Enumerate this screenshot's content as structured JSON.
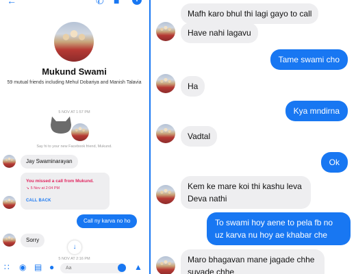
{
  "left": {
    "header_icons": [
      "back-arrow-icon",
      "phone-icon",
      "video-icon",
      "info-icon"
    ],
    "profile": {
      "name": "Mukund Swami",
      "mutual": "59 mutual friends including Mehul Dobariya and Manish Talavia"
    },
    "timestamp_1": "5 NOV AT 1:57 PM",
    "say_hi": "Say hi to your new Facebook friend, Mukund.",
    "messages": {
      "m1": "Jay Swaminarayan",
      "missed_title": "You missed a call from Mukund.",
      "missed_time": "5 Nov at 2:04 PM",
      "callback": "CALL BACK",
      "m2": "Call ny karva no ho",
      "m3": "Sorry"
    },
    "timestamp_2": "5 NOV AT 2:16 PM",
    "composer": {
      "placeholder": "Aa",
      "icons": [
        "apps-icon",
        "camera-icon",
        "photo-icon",
        "microphone-icon",
        "emoji-icon",
        "thumbs-up-icon"
      ]
    }
  },
  "right": {
    "messages": [
      {
        "side": "left",
        "text": "Mafh karo bhul thi lagi gayo to call"
      },
      {
        "side": "left",
        "text": "Have nahi lagavu"
      },
      {
        "side": "right",
        "text": "Tame swami cho"
      },
      {
        "side": "left",
        "text": "Ha"
      },
      {
        "side": "right",
        "text": "Kya mndirna"
      },
      {
        "side": "left",
        "text": "Vadtal"
      },
      {
        "side": "right",
        "text": "Ok"
      },
      {
        "side": "left",
        "text": "Kem ke mare koi thi kashu leva Deva nathi"
      },
      {
        "side": "right",
        "text": "To swami hoy aene to pela fb no uz karva nu hoy ae khabar che"
      },
      {
        "side": "left",
        "text": "Maro bhagavan mane jagade chhe suvade chhe"
      }
    ]
  },
  "colors": {
    "accent": "#1877f2",
    "bubble_incoming": "#eeeef0",
    "missed_call": "#e0245e"
  }
}
